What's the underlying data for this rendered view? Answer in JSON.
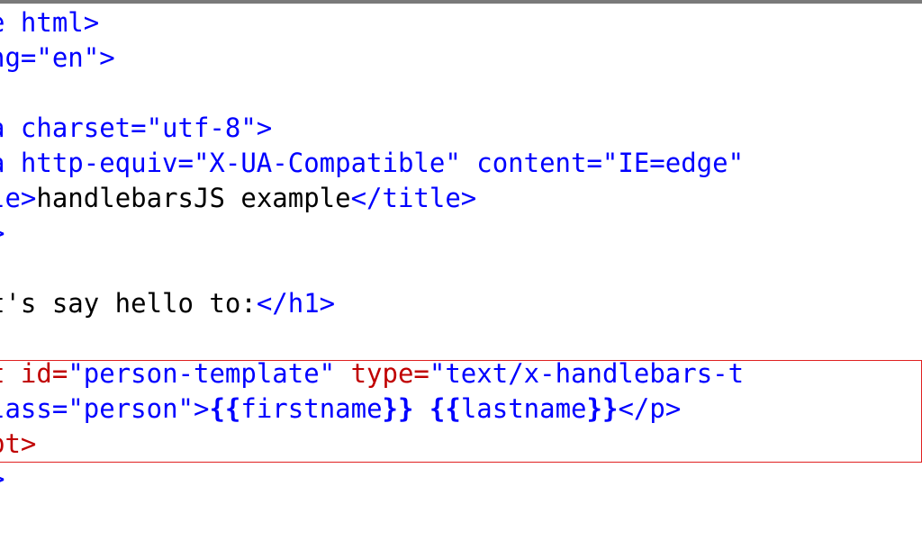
{
  "colors": {
    "tag": "#0000ff",
    "attr": "#c00000",
    "text": "#000000",
    "highlight_border": "#e02020",
    "top_border": "#7a7a7a"
  },
  "code_lines": [
    {
      "segments": [
        {
          "text": "e html>",
          "color": "blue"
        }
      ]
    },
    {
      "segments": [
        {
          "text": "ng=\"en\">",
          "color": "blue"
        }
      ]
    },
    {
      "segments": []
    },
    {
      "segments": [
        {
          "text": "a charset=\"utf-8\">",
          "color": "blue"
        }
      ]
    },
    {
      "segments": [
        {
          "text": "a http-equiv=\"X-UA-Compatible\" content=\"IE=edge\"",
          "color": "blue"
        }
      ]
    },
    {
      "segments": [
        {
          "text": "le>",
          "color": "blue"
        },
        {
          "text": "handlebarsJS example",
          "color": "black"
        },
        {
          "text": "</title>",
          "color": "blue"
        }
      ]
    },
    {
      "segments": [
        {
          "text": ">",
          "color": "blue"
        }
      ]
    },
    {
      "segments": []
    },
    {
      "segments": [
        {
          "text": "t's say hello to:",
          "color": "black"
        },
        {
          "text": "</h1>",
          "color": "blue"
        }
      ]
    },
    {
      "segments": []
    },
    {
      "segments": [
        {
          "text": "t ",
          "color": "red"
        },
        {
          "text": "id=",
          "color": "red"
        },
        {
          "text": "\"person-template\"",
          "color": "blue"
        },
        {
          "text": " type=",
          "color": "red"
        },
        {
          "text": "\"text/x-handlebars-t",
          "color": "blue"
        }
      ]
    },
    {
      "segments": [
        {
          "text": "lass=",
          "color": "blue"
        },
        {
          "text": "\"person\"",
          "color": "blue"
        },
        {
          "text": ">",
          "color": "blue"
        },
        {
          "text": "{{",
          "color": "blue",
          "bold": true
        },
        {
          "text": "firstname",
          "color": "blue"
        },
        {
          "text": "}}",
          "color": "blue",
          "bold": true
        },
        {
          "text": " ",
          "color": "black"
        },
        {
          "text": "{{",
          "color": "blue",
          "bold": true
        },
        {
          "text": "lastname",
          "color": "blue"
        },
        {
          "text": "}}",
          "color": "blue",
          "bold": true
        },
        {
          "text": "</p>",
          "color": "blue"
        }
      ]
    },
    {
      "segments": [
        {
          "text": "pt>",
          "color": "red"
        }
      ]
    },
    {
      "segments": [
        {
          "text": ">",
          "color": "blue"
        }
      ]
    }
  ]
}
